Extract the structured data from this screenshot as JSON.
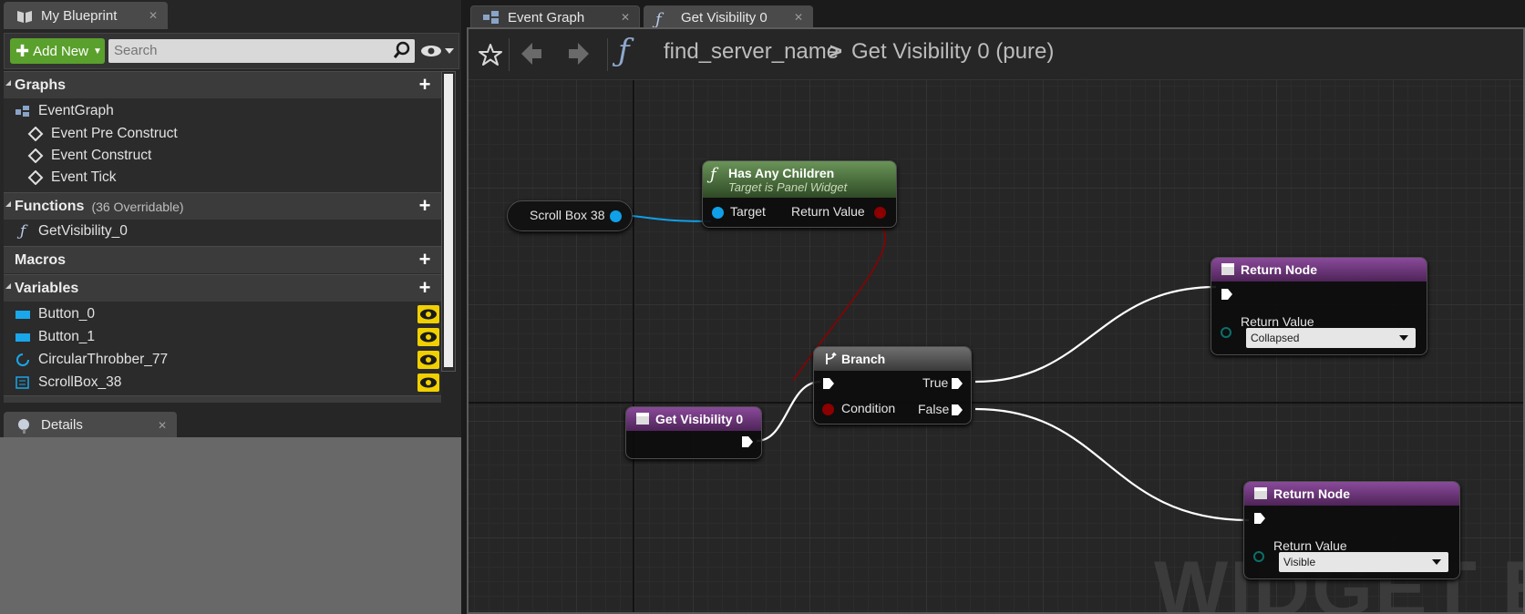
{
  "left_panel": {
    "tab_title": "My Blueprint",
    "add_new_label": "Add New",
    "search_placeholder": "Search",
    "sections": {
      "graphs": {
        "label": "Graphs"
      },
      "functions": {
        "label": "Functions",
        "sub": "(36 Overridable)"
      },
      "macros": {
        "label": "Macros"
      },
      "variables": {
        "label": "Variables"
      }
    },
    "graph_items": {
      "event_graph": "EventGraph",
      "events": [
        "Event Pre Construct",
        "Event Construct",
        "Event Tick"
      ]
    },
    "functions": [
      "GetVisibility_0"
    ],
    "variables": [
      "Button_0",
      "Button_1",
      "CircularThrobber_77",
      "ScrollBox_38"
    ],
    "details_tab": "Details"
  },
  "editor_tabs": [
    {
      "label": "Event Graph"
    },
    {
      "label": "Get Visibility 0"
    }
  ],
  "breadcrumb": {
    "parent": "find_server_name",
    "separator": ">",
    "current": "Get Visibility 0 (pure)"
  },
  "nodes": {
    "scroll_box": {
      "label": "Scroll Box 38"
    },
    "has_any_children": {
      "title": "Has Any Children",
      "subtitle": "Target is Panel Widget",
      "pin_in": "Target",
      "pin_out": "Return Value"
    },
    "get_visibility": {
      "title": "Get Visibility 0"
    },
    "branch": {
      "title": "Branch",
      "pin_condition": "Condition",
      "pin_true": "True",
      "pin_false": "False"
    },
    "return_top": {
      "title": "Return Node",
      "pin_label": "Return Value",
      "value": "Collapsed"
    },
    "return_bottom": {
      "title": "Return Node",
      "pin_label": "Return Value",
      "value": "Visible"
    }
  },
  "watermark": "WIDGET BLU",
  "colors": {
    "add_new": "#5aa02c",
    "pure_header": "#7a3f8a",
    "function_header": "#4f7a3a",
    "object_pin": "#0fa0e8",
    "bool_pin": "#8c0000",
    "eye_toggle": "#f0d000"
  }
}
